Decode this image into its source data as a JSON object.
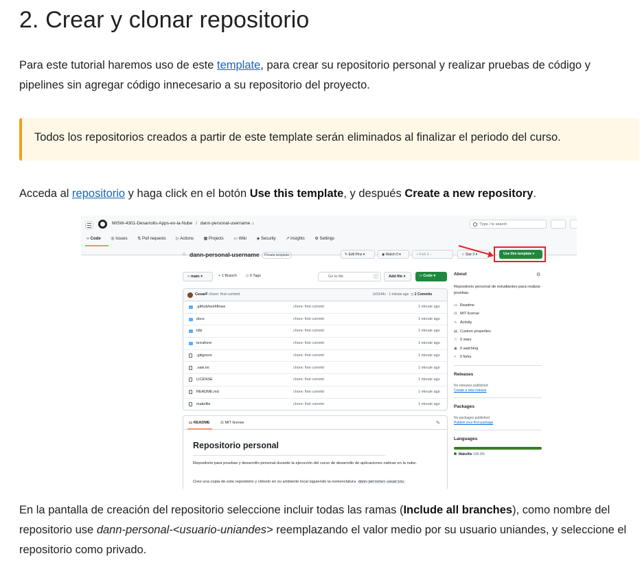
{
  "heading": "2. Crear y clonar repositorio",
  "intro": {
    "before": "Para este tutorial haremos uso de este ",
    "link": "template",
    "after": ", para crear su repositorio personal y realizar pruebas de código y pipelines sin agregar código innecesario a su repositorio del proyecto."
  },
  "warning": "Todos los repositorios creados a partir de este template serán eliminados al finalizar el periodo del curso.",
  "step": {
    "t1": "Acceda al ",
    "link": "repositorio",
    "t2": " y haga click en el botón ",
    "b1": "Use this template",
    "t3": ", y después ",
    "b2": "Create a new repository",
    "t4": "."
  },
  "screenshot": {
    "breadcrumb_org": "MISW-4301-Desarrollo-Apps-en-la-Nube",
    "breadcrumb_sep": "/",
    "breadcrumb_repo": "dann-personal-username",
    "search_placeholder": "Type / to search",
    "tabs": [
      "Code",
      "Issues",
      "Pull requests",
      "Actions",
      "Projects",
      "Wiki",
      "Security",
      "Insights",
      "Settings"
    ],
    "repo_name": "dann-personal-username",
    "visibility": "Private template",
    "edit_pins": "Edit Pins",
    "watch": "Watch",
    "watch_count": "0",
    "fork": "Fork",
    "fork_count": "0",
    "star": "Star",
    "star_count": "0",
    "use_template": "Use this template",
    "branch": "main",
    "branches": "1 Branch",
    "tags": "0 Tags",
    "go_to_file": "Go to file",
    "go_to_file_key": "t",
    "add_file": "Add file",
    "code_button": "Code",
    "commit_author": "CesarF",
    "commit_message": "chore: first commit",
    "commit_meta": "2c5144c · 1 minute ago",
    "commit_count": "2 Commits",
    "files": [
      {
        "name": ".github/workflows",
        "type": "dir",
        "msg": "chore: first commit",
        "time": "1 minute ago"
      },
      {
        "name": "docs",
        "type": "dir",
        "msg": "chore: first commit",
        "time": "1 minute ago"
      },
      {
        "name": "k8s",
        "type": "dir",
        "msg": "chore: first commit",
        "time": "1 minute ago"
      },
      {
        "name": "terraform",
        "type": "dir",
        "msg": "chore: first commit",
        "time": "1 minute ago"
      },
      {
        "name": ".gitignore",
        "type": "file",
        "msg": "chore: first commit",
        "time": "1 minute ago"
      },
      {
        "name": ".vale.ini",
        "type": "file",
        "msg": "chore: first commit",
        "time": "1 minute ago"
      },
      {
        "name": "LICENSE",
        "type": "file",
        "msg": "chore: first commit",
        "time": "1 minute ago"
      },
      {
        "name": "README.md",
        "type": "file",
        "msg": "chore: first commit",
        "time": "1 minute ago"
      },
      {
        "name": "makefile",
        "type": "file",
        "msg": "chore: first commit",
        "time": "1 minute ago"
      }
    ],
    "readme_tab": "README",
    "license_tab": "MIT license",
    "readme_title": "Repositorio personal",
    "readme_p1": "Repositorio para pruebas y desarrollo personal durante la ejecución del curso de desarrollo de aplicaciones nativas en la nube.",
    "readme_p2": "Cree una copia de este repositorio y clónelo en su ambiente local siguiendo la nomenclatura",
    "readme_code": "dann-personal-usuariou",
    "about_title": "About",
    "about_desc": "Repositorio personal de estudiantes para realizar pruebas.",
    "about_items": [
      "Readme",
      "MIT license",
      "Activity",
      "Custom properties",
      "0 stars",
      "0 watching",
      "0 forks"
    ],
    "releases_title": "Releases",
    "releases_none": "No releases published",
    "releases_link": "Create a new release",
    "packages_title": "Packages",
    "packages_none": "No packages published",
    "packages_link": "Publish your first package",
    "languages_title": "Languages",
    "language": "Makefile",
    "language_pct": "100.0%"
  },
  "final": {
    "t1": "En la pantalla de creación del repositorio seleccione incluir todas las ramas (",
    "b1": "Include all branches",
    "t2": "), como nombre del repositorio use ",
    "i1": "dann-personal-<usuario-uniandes>",
    "t3": " reemplazando el valor medio por su usuario uniandes, y seleccione el repositorio como privado."
  },
  "colors": {
    "link": "#1565c0",
    "admonition_bg": "#fff8e6",
    "admonition_border": "#f0a020",
    "gh_green": "#1f883d",
    "highlight_red": "#e0242b"
  }
}
